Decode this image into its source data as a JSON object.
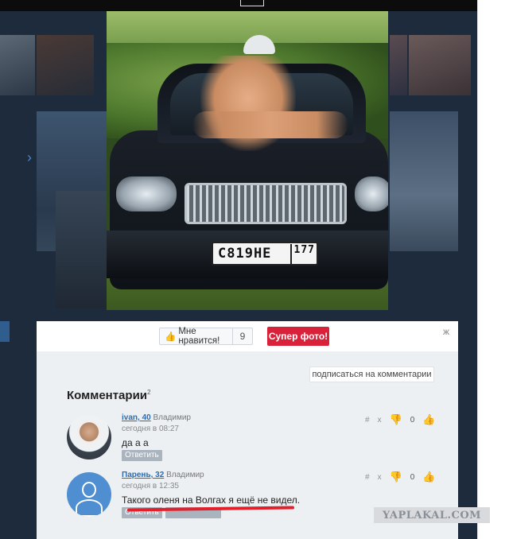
{
  "photo": {
    "plate_number": "С819НЕ",
    "plate_region": "177"
  },
  "actions": {
    "like_label": "Мне нравится!",
    "like_count": "9",
    "super_label": "Супер фото!",
    "close_label": "ж",
    "subscribe_label": "подписаться на комментарии"
  },
  "comments_section": {
    "title": "Комментарии",
    "count": "2",
    "items": [
      {
        "user": "ivan, 40",
        "name": "Владимир",
        "time": "сегодня в 08:27",
        "text": "да а а",
        "reply_label": "Ответить",
        "hash": "#",
        "x": "x",
        "score": "0"
      },
      {
        "user": "Парень, 32",
        "name": "Владимир",
        "time": "сегодня в 12:35",
        "text": "Такого оленя на Волгах я ещё не видел.",
        "reply_label": "Ответить",
        "hash": "#",
        "x": "x",
        "score": "0"
      }
    ]
  },
  "watermark": "YAPLAKAL.COM",
  "colors": {
    "accent_red": "#d9223a",
    "link_blue": "#2b6cb0",
    "avatar_blue": "#4f8fd1"
  }
}
